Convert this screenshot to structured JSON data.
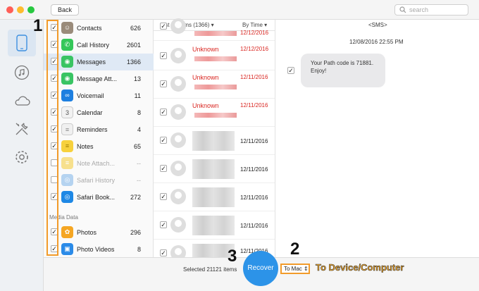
{
  "toolbar": {
    "back_label": "Back",
    "search_placeholder": "search"
  },
  "window_controls": {
    "close": "#ff5f57",
    "minimize": "#febc2e",
    "zoom": "#28c840"
  },
  "sidebar_nav": [
    {
      "icon": "phone-icon",
      "active": true
    },
    {
      "icon": "music-icon"
    },
    {
      "icon": "cloud-icon"
    },
    {
      "icon": "tools-icon"
    },
    {
      "icon": "gear-icon"
    }
  ],
  "categories": [
    {
      "label": "Contacts",
      "count": "626",
      "color": "#9a8b7a",
      "checked": true
    },
    {
      "label": "Call History",
      "count": "2601",
      "color": "#35c759",
      "checked": true
    },
    {
      "label": "Messages",
      "count": "1366",
      "color": "#39c463",
      "checked": true,
      "selected": true
    },
    {
      "label": "Message Att...",
      "count": "13",
      "color": "#39c463",
      "checked": true
    },
    {
      "label": "Voicemail",
      "count": "11",
      "color": "#1d7fe0",
      "checked": true
    },
    {
      "label": "Calendar",
      "count": "8",
      "color": "#f2f2f2",
      "checked": true
    },
    {
      "label": "Reminders",
      "count": "4",
      "color": "#f0f0f0",
      "checked": true
    },
    {
      "label": "Notes",
      "count": "65",
      "color": "#f7d13d",
      "checked": true
    },
    {
      "label": "Note Attach...",
      "count": "--",
      "color": "#f7e08d",
      "checked": false,
      "dim": true
    },
    {
      "label": "Safari History",
      "count": "--",
      "color": "#b5d3f0",
      "checked": false,
      "dim": true
    },
    {
      "label": "Safari Book...",
      "count": "272",
      "color": "#1e88e5",
      "checked": true
    }
  ],
  "media_section": "Media Data",
  "media": [
    {
      "label": "Photos",
      "count": "296",
      "color": "#f5a623",
      "checked": true
    },
    {
      "label": "Photo Videos",
      "count": "8",
      "color": "#2b8be8",
      "checked": true
    }
  ],
  "list": {
    "header": "List all items (1366)",
    "sort": "By Time",
    "rows": [
      {
        "name": "",
        "date": "12/12/2016",
        "red": true
      },
      {
        "name": "Unknown",
        "date": "12/12/2016",
        "red": true
      },
      {
        "name": "Unknown",
        "date": "12/11/2016",
        "red": true
      },
      {
        "name": "Unknown",
        "date": "12/11/2016",
        "red": true
      },
      {
        "name": "",
        "date": "12/11/2016",
        "red": false
      },
      {
        "name": "",
        "date": "12/11/2016",
        "red": false
      },
      {
        "name": "",
        "date": "12/11/2016",
        "red": false
      },
      {
        "name": "",
        "date": "12/11/2016",
        "red": false
      },
      {
        "name": "",
        "date": "12/11/2016",
        "red": false
      }
    ]
  },
  "detail": {
    "type": "<SMS>",
    "timestamp": "12/08/2016 22:55 PM",
    "message": "Your Path code is 71881. Enjoy!"
  },
  "footer": {
    "selected_text": "Selected 21121 items",
    "recover_label": "Recover",
    "destination": "To Mac"
  },
  "callouts": {
    "one": "1",
    "two": "2",
    "three": "3",
    "to_device": "To Device/Computer",
    "accent": "#f29b2a"
  }
}
